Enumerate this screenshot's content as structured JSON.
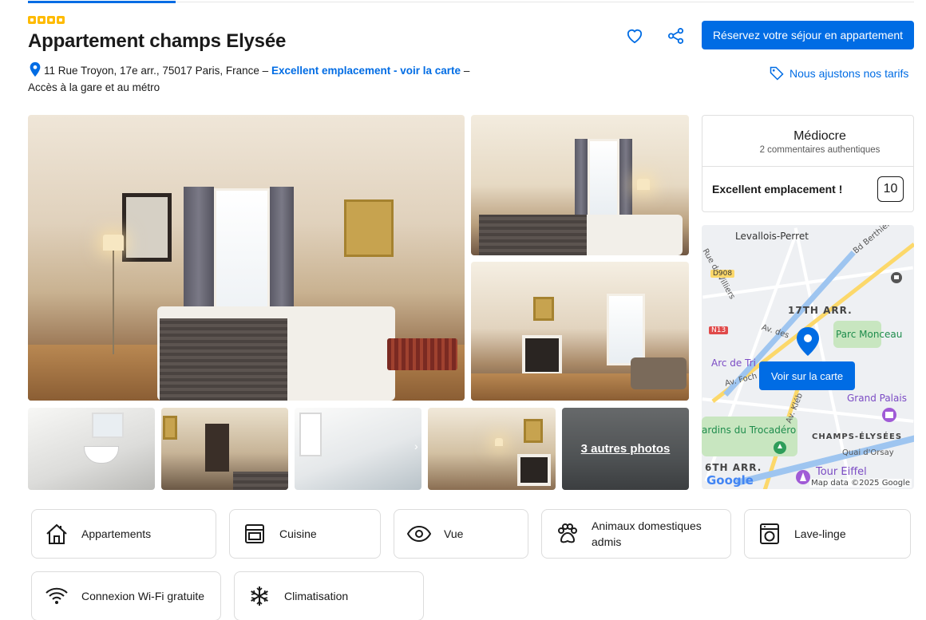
{
  "header": {
    "star_count": 4,
    "title": "Appartement champs Elysée",
    "address": "11 Rue Troyon, 17e arr., 75017 Paris, France –",
    "location_link": "Excellent emplacement - voir la carte",
    "address_suffix": "–",
    "address_line2": "Accès à la gare et au métro",
    "reserve_label": "Réservez votre séjour en appartement",
    "price_match_label": "Nous ajustons nos tarifs"
  },
  "gallery": {
    "more_photos_label": "3 autres photos"
  },
  "review": {
    "rating_word": "Médiocre",
    "review_count": "2 commentaires authentiques",
    "location_label": "Excellent emplacement !",
    "location_score": "10"
  },
  "map": {
    "button_label": "Voir sur la carte",
    "labels": {
      "levallois": "Levallois-Perret",
      "villiers": "Rue de Villiers",
      "berthier": "Bd Berthier",
      "d908": "D908",
      "arr17": "17TH ARR.",
      "avdes": "Av. des",
      "monceau": "Parc Monceau",
      "n13": "N13",
      "arc": "Arc de Tri",
      "foch": "Av. Foch",
      "kleber": "Av. Kléb",
      "grandpalais": "Grand Palais",
      "trocadero": "ardins du Trocadéro",
      "champs": "CHAMPS-ÉLYSÉES",
      "orsay": "Quai d'Orsay",
      "arr6": "6TH ARR.",
      "eiffel": "Tour Eiffel",
      "google": "Google",
      "copyright": "Map data ©2025 Google"
    }
  },
  "facilities": [
    {
      "label": "Appartements",
      "icon": "house-icon"
    },
    {
      "label": "Cuisine",
      "icon": "oven-icon"
    },
    {
      "label": "Vue",
      "icon": "eye-icon"
    },
    {
      "label": "Animaux domestiques admis",
      "icon": "paw-icon"
    },
    {
      "label": "Lave-linge",
      "icon": "washing-machine-icon"
    },
    {
      "label": "Connexion Wi-Fi gratuite",
      "icon": "wifi-icon"
    },
    {
      "label": "Climatisation",
      "icon": "snowflake-icon"
    }
  ],
  "colors": {
    "accent": "#006ce4",
    "star": "#febb02",
    "text": "#1a1a1a"
  }
}
